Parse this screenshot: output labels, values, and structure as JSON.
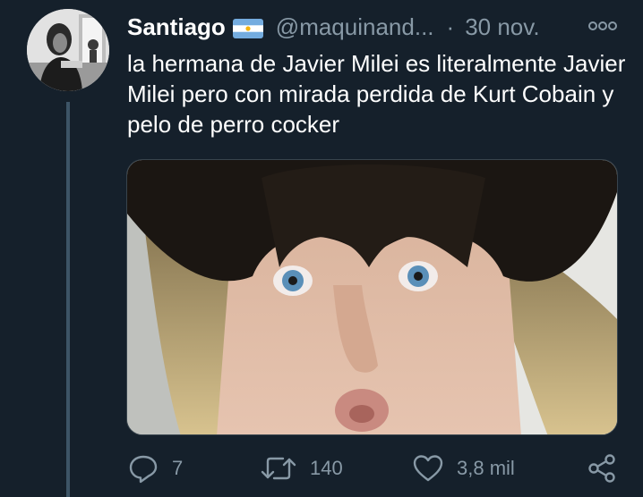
{
  "tweet": {
    "author_name": "Santiago",
    "flag": "argentina-flag-icon",
    "handle": "@maquinand...",
    "separator": "·",
    "date": "30 nov.",
    "text": "la hermana de Javier Milei es literalmente Javier Milei pero con mirada perdida de Kurt Cobain y pelo de perro cocker"
  },
  "actions": {
    "replies": "7",
    "retweets": "140",
    "likes": "3,8 mil"
  },
  "colors": {
    "background": "#15202b",
    "secondary_text": "#8899a6",
    "thread_line": "#3d5466"
  }
}
